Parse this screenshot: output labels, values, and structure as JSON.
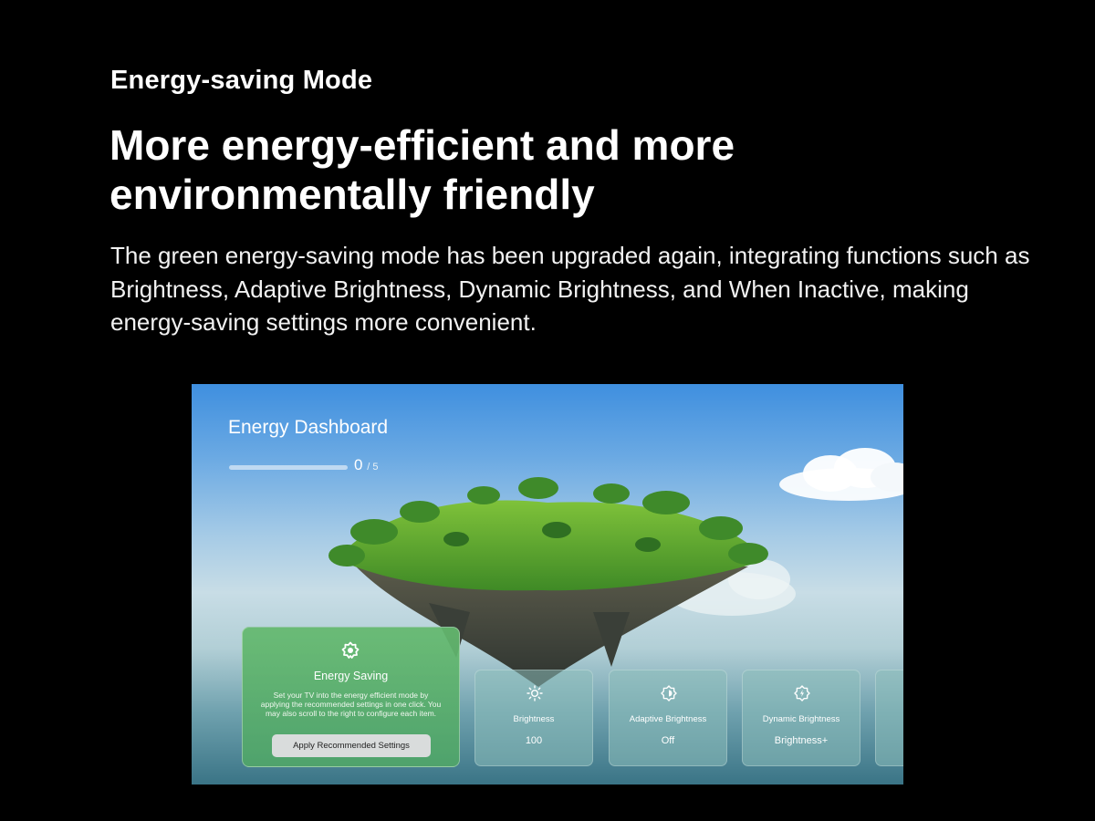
{
  "header": {
    "eyebrow": "Energy-saving Mode",
    "headline": "More energy-efficient and more environmentally friendly",
    "description": "The green energy-saving mode has been upgraded again, integrating functions such as Brightness, Adaptive Brightness, Dynamic Brightness, and When Inactive, making energy-saving settings more convenient."
  },
  "dashboard": {
    "title": "Energy Dashboard",
    "progress": {
      "done": "0",
      "total": "/ 5",
      "fraction": 0
    },
    "energy_saving_card": {
      "icon": "energy-saving-icon",
      "title": "Energy Saving",
      "body": "Set your TV into the energy efficient mode by applying the recommended settings in one click. You may also scroll to the right to configure each item.",
      "button_label": "Apply Recommended Settings",
      "color": "#5fb56b"
    },
    "setting_cards": [
      {
        "icon": "brightness-icon",
        "label": "Brightness",
        "value": "100"
      },
      {
        "icon": "adaptive-brightness-icon",
        "label": "Adaptive Brightness",
        "value": "Off"
      },
      {
        "icon": "dynamic-brightness-icon",
        "label": "Dynamic Brightness",
        "value": "Brightness+"
      }
    ]
  }
}
